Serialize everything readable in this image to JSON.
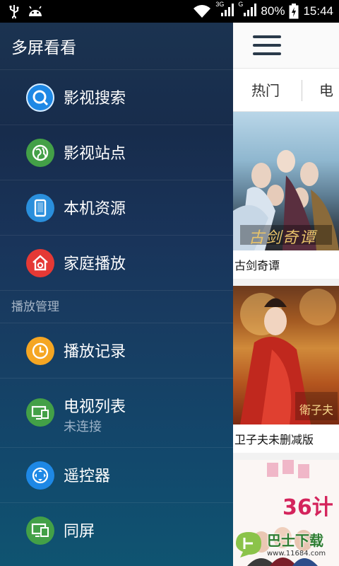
{
  "status_bar": {
    "net_a": "3G",
    "net_b": "G",
    "battery": "80%",
    "time": "15:44"
  },
  "drawer": {
    "title": "多屏看看",
    "items": [
      {
        "label": "影视搜索",
        "icon": "search-icon",
        "color": "#1e88e5"
      },
      {
        "label": "影视站点",
        "icon": "globe-icon",
        "color": "#43a047"
      },
      {
        "label": "本机资源",
        "icon": "phone-icon",
        "color": "#2a8fdc"
      },
      {
        "label": "家庭播放",
        "icon": "home-icon",
        "color": "#e53935"
      }
    ],
    "section": "播放管理",
    "manage_items": [
      {
        "label": "播放记录",
        "icon": "clock-icon",
        "color": "#f5a623"
      },
      {
        "label": "电视列表",
        "sublabel": "未连接",
        "icon": "tv-icon",
        "color": "#43a047"
      },
      {
        "label": "遥控器",
        "icon": "remote-icon",
        "color": "#1e88e5"
      },
      {
        "label": "同屏",
        "icon": "screen-mirror-icon",
        "color": "#43a047"
      }
    ]
  },
  "content": {
    "tabs": [
      "热门",
      "电影"
    ],
    "posters": [
      {
        "title": "古剑奇谭",
        "art_text": "古剑奇谭"
      },
      {
        "title": "卫子夫未删减版",
        "art_text": "衛子夫"
      },
      {
        "title": "",
        "art_text": "36计"
      }
    ]
  },
  "watermark": {
    "brand": "巴士下载",
    "url": "www.11684.com"
  }
}
